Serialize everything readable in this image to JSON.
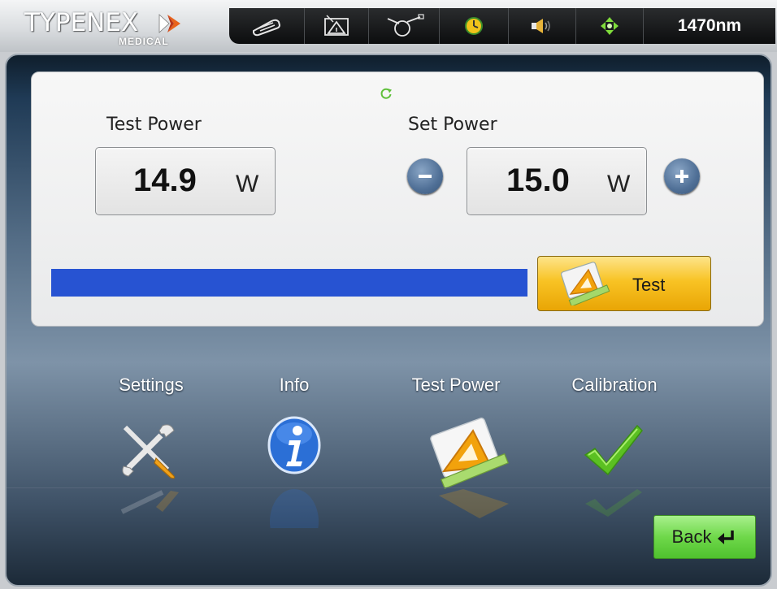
{
  "header": {
    "brand": "TYPENEX",
    "brand_sub": "MEDICAL",
    "wavelength": "1470nm",
    "status_icons": [
      "foot-pedal-icon",
      "aiming-beam-icon",
      "fiber-icon",
      "timer-icon",
      "speaker-icon",
      "crosshair-icon"
    ]
  },
  "test_panel": {
    "test_power_label": "Test Power",
    "test_power_value": "14.9",
    "test_power_unit": "W",
    "set_power_label": "Set Power",
    "set_power_value": "15.0",
    "set_power_unit": "W",
    "progress_fraction": 1.0,
    "test_button_label": "Test"
  },
  "nav": [
    {
      "label": "Settings",
      "icon": "tools-icon"
    },
    {
      "label": "Info",
      "icon": "info-icon"
    },
    {
      "label": "Test Power",
      "icon": "test-power-icon"
    },
    {
      "label": "Calibration",
      "icon": "checkmark-icon"
    }
  ],
  "back_button_label": "Back",
  "colors": {
    "progress": "#2753d2",
    "test_button": "#f8c324",
    "back_button": "#6fd84a"
  }
}
